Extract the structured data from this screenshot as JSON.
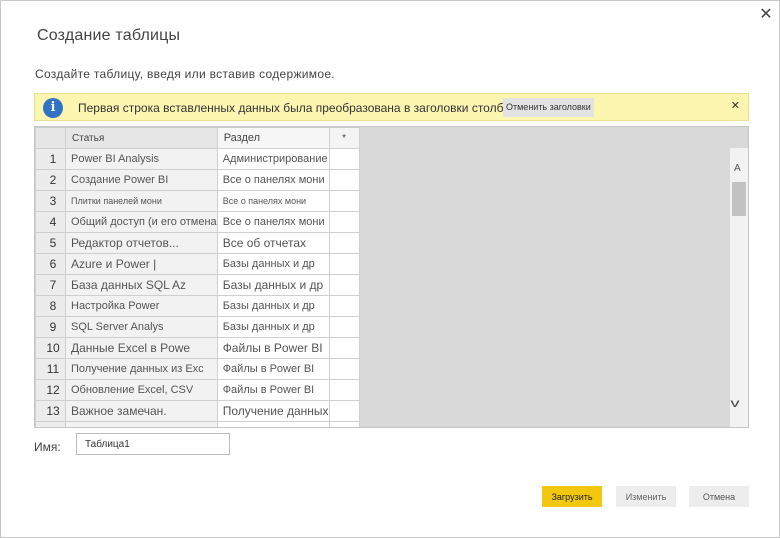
{
  "dialog": {
    "title": "Создание таблицы",
    "subtitle": "Создайте таблицу, введя или вставив содержимое.",
    "close_glyph": "✕"
  },
  "banner": {
    "icon": "info-icon",
    "icon_glyph": "i",
    "text": "Первая строка вставленных данных была преобразована в заголовки столбцов",
    "undo_label": "Отменить заголовки",
    "close_glyph": "✕"
  },
  "grid": {
    "headers": [
      "Статья",
      "Раздел",
      "*"
    ],
    "rows": [
      {
        "num": "1",
        "a": "Power BI Analysis",
        "b": "Администрирование"
      },
      {
        "num": "2",
        "a": "Создание Power BI",
        "b": "Все о панелях мони"
      },
      {
        "num": "3",
        "a": "Плитки панелей мони",
        "b": "Все о панелях мони"
      },
      {
        "num": "4",
        "a": "Общий доступ (и его отмена",
        "b": "Все о панелях мони"
      },
      {
        "num": "5",
        "a": "Редактор отчетов...",
        "b": "Все об отчетах"
      },
      {
        "num": "6",
        "a": "Azure и Power |",
        "b": "Базы данных и др"
      },
      {
        "num": "7",
        "a": "База данных SQL Az",
        "b": "Базы данных и др"
      },
      {
        "num": "8",
        "a": "Настройка Power",
        "b": "Базы данных и др"
      },
      {
        "num": "9",
        "a": "SQL Server Analys",
        "b": "Базы данных и др"
      },
      {
        "num": "10",
        "a": "Данные Excel в Powe",
        "b": "Файлы в Power BI"
      },
      {
        "num": "11",
        "a": "Получение данных из Exc",
        "b": "Файлы в Power BI"
      },
      {
        "num": "12",
        "a": "Обновление Excel, CSV",
        "b": "Файлы в Power BI"
      },
      {
        "num": "13",
        "a": "Важное замечан.",
        "b": "Получение данных"
      },
      {
        "num": "",
        "a": "",
        "b": ""
      }
    ],
    "scroll_up_glyph": "A",
    "scroll_down_glyph": "v"
  },
  "name_field": {
    "label": "Имя:",
    "value": "Таблица1"
  },
  "buttons": {
    "load": "Загрузить",
    "edit": "Изменить",
    "cancel": "Отмена"
  },
  "colors": {
    "accent": "#f2c80f",
    "banner_bg": "#fcf6b1",
    "info_blue": "#2f73c2"
  }
}
